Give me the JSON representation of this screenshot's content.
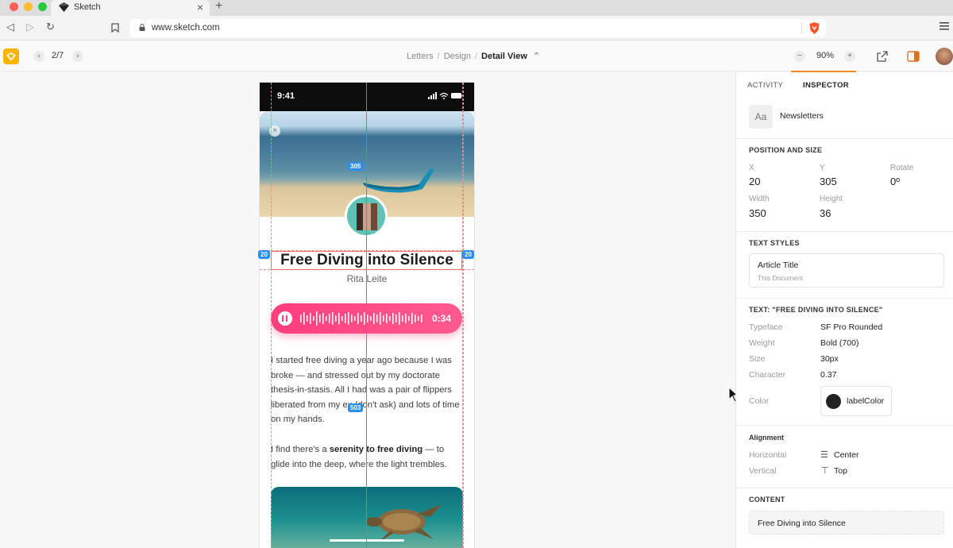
{
  "browser": {
    "tab_title": "Sketch",
    "url": "www.sketch.com"
  },
  "toolbar": {
    "pager": "2/7",
    "breadcrumb": [
      "Letters",
      "Design",
      "Detail View"
    ],
    "zoom": "90%"
  },
  "canvas": {
    "status_time": "9:41",
    "article_title": "Free Diving into Silence",
    "author": "Rita Leite",
    "player_time": "0:34",
    "paragraph1": "I started free diving a year ago because I was broke — and stressed out by my doctorate thesis-in-stasis. All I had was a pair of flippers liberated from my ex (don't ask) and lots of time on my hands.",
    "paragraph2_before": "I find there's a ",
    "paragraph2_bold": "serenity to free diving",
    "paragraph2_after": " — to glide into the deep, where the light trembles.",
    "measure_top": "305",
    "measure_left": "20",
    "measure_right": "20",
    "measure_bottom": "503"
  },
  "inspector": {
    "tabs": [
      "ACTIVITY",
      "INSPECTOR"
    ],
    "active_tab": "INSPECTOR",
    "symbol_badge": "Aa",
    "symbol_name": "Newsletters",
    "position_title": "POSITION AND SIZE",
    "x_label": "X",
    "x_value": "20",
    "y_label": "Y",
    "y_value": "305",
    "rotate_label": "Rotate",
    "rotate_value": "0º",
    "width_label": "Width",
    "width_value": "350",
    "height_label": "Height",
    "height_value": "36",
    "text_styles_title": "TEXT STYLES",
    "style_name": "Article Title",
    "style_source": "This Document",
    "text_title": "TEXT: \"FREE DIVING INTO SILENCE\"",
    "typeface_label": "Typeface",
    "typeface_value": "SF Pro Rounded",
    "weight_label": "Weight",
    "weight_value": "Bold (700)",
    "size_label": "Size",
    "size_value": "30px",
    "character_label": "Character",
    "character_value": "0.37",
    "color_label": "Color",
    "color_value": "labelColor",
    "alignment_title": "Alignment",
    "horizontal_label": "Horizontal",
    "horizontal_value": "Center",
    "vertical_label": "Vertical",
    "vertical_value": "Top",
    "content_title": "CONTENT",
    "content_value": "Free Diving into Silence"
  },
  "colors": {
    "accent": "#f08a24",
    "player": "#ff3d7f",
    "measure": "#2b8ef0",
    "guide": "#e98a8a"
  }
}
